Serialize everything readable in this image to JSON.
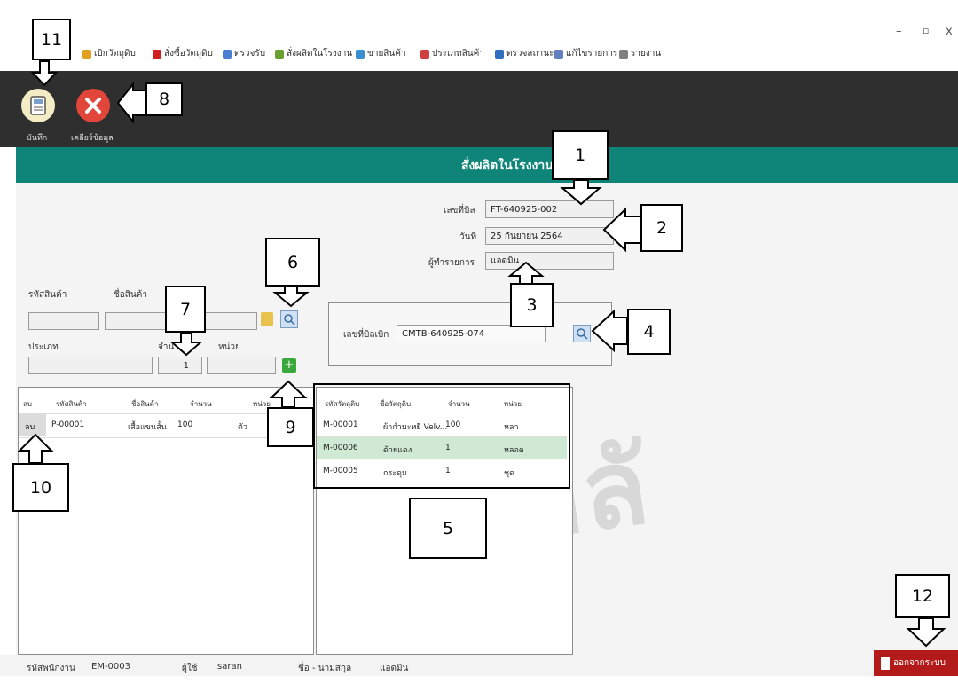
{
  "window_controls": {
    "minimize": "–",
    "maximize": "▫",
    "close": "x"
  },
  "menu": [
    {
      "label": "เบิกวัตถุดิบ",
      "icon": "box-icon",
      "color": "#e0a020"
    },
    {
      "label": "สั่งซื้อวัตถุดิบ",
      "icon": "cart-icon",
      "color": "#d02020"
    },
    {
      "label": "ตรวจรับ",
      "icon": "clipboard-icon",
      "color": "#4a7ed0"
    },
    {
      "label": "สั่งผลิตในโรงงาน",
      "icon": "factory-icon",
      "color": "#6aa030"
    },
    {
      "label": "ขายสินค้า",
      "icon": "sale-icon",
      "color": "#3a8fd0"
    },
    {
      "label": "ประเภทสินค้า",
      "icon": "category-icon",
      "color": "#d04040"
    },
    {
      "label": "ตรวจสถานะ",
      "icon": "status-icon",
      "color": "#3070c0"
    },
    {
      "label": "แก้ไขรายการ",
      "icon": "edit-icon",
      "color": "#6080c0"
    },
    {
      "label": "รายงาน",
      "icon": "report-icon",
      "color": "#808080"
    }
  ],
  "toolbar": {
    "save_label": "บันทึก",
    "clear_label": "เคลียร์ข้อมูล"
  },
  "page_title": "สั่งผลิตในโรงงาน",
  "doc": {
    "bill_no_label": "เลขที่บิล",
    "bill_no": "FT-640925-002",
    "date_label": "วันที่",
    "date": "25 กันยายน 2564",
    "operator_label": "ผู้ทำรายการ",
    "operator": "แอดมิน"
  },
  "product_form": {
    "code_label": "รหัสสินค้า",
    "name_label": "ชื่อสินค้า",
    "type_label": "ประเภท",
    "qty_label": "จำนวน",
    "unit_label": "หน่วย",
    "qty_value": "1"
  },
  "withdraw": {
    "label": "เลขที่บิลเบิก",
    "value": "CMTB-640925-074"
  },
  "product_table": {
    "headers": [
      "ลบ",
      "รหัสสินค้า",
      "ชื่อสินค้า",
      "จำนวน",
      "หน่วย"
    ],
    "rows": [
      {
        "delete": "ลบ",
        "code": "P-00001",
        "name": "เสื้อแขนสั้น",
        "qty": "100",
        "unit": "ตัว"
      }
    ]
  },
  "material_table": {
    "headers": [
      "รหัสวัตถุดิบ",
      "ชื่อวัตถุดิบ",
      "จำนวน",
      "หน่วย"
    ],
    "rows": [
      {
        "code": "M-00001",
        "name": "ผ้ากำมะหยี่ Velv...",
        "qty": "100",
        "unit": "หลา"
      },
      {
        "code": "M-00006",
        "name": "ด้ายแดง",
        "qty": "1",
        "unit": "หลอด"
      },
      {
        "code": "M-00005",
        "name": "กระดุม",
        "qty": "1",
        "unit": "ชุด"
      }
    ]
  },
  "callouts": [
    "1",
    "2",
    "3",
    "4",
    "5",
    "6",
    "7",
    "8",
    "9",
    "10",
    "11",
    "12"
  ],
  "status": {
    "emp_label": "รหัสพนักงาน",
    "emp": "EM-0003",
    "user_label": "ผู้ใช้",
    "user": "saran",
    "name_label": "ชื่อ - นามสกุล",
    "name": "แอดมิน"
  },
  "exit_label": "ออกจากระบบ",
  "colors": {
    "header": "#0e8578",
    "toolbar": "#2f2f2f",
    "exit": "#b31b1b"
  }
}
